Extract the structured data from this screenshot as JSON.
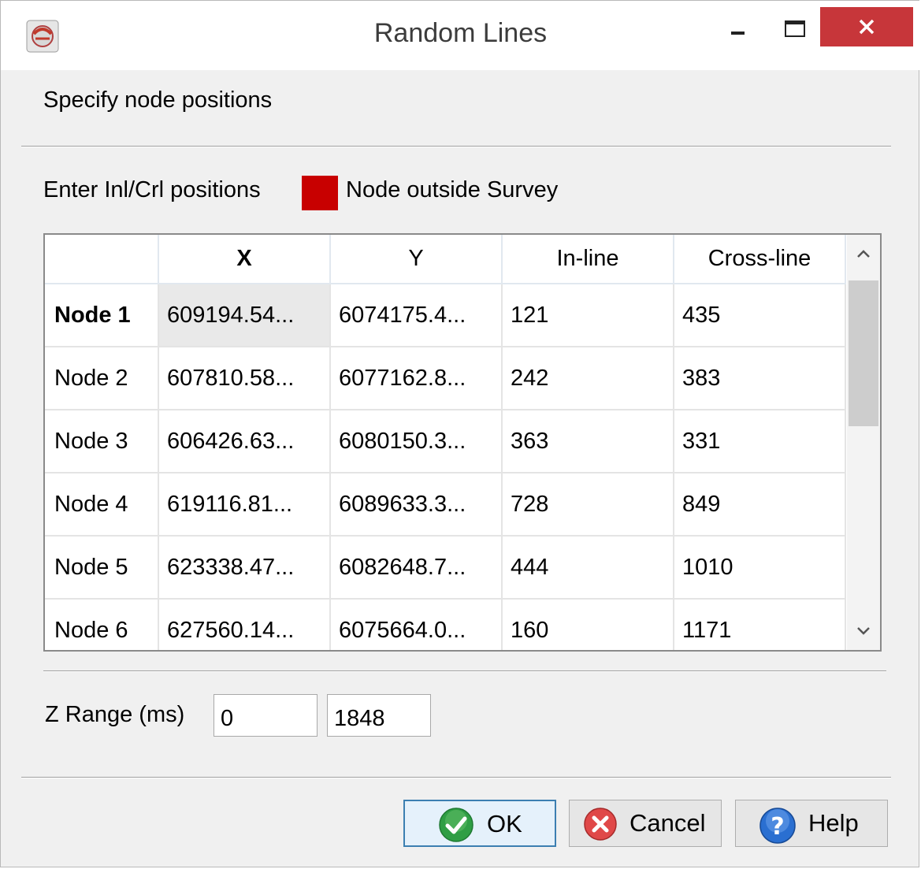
{
  "window": {
    "title": "Random Lines"
  },
  "prompt": "Specify node positions",
  "legend": {
    "label": "Enter Inl/Crl positions",
    "swatch_color": "#c80000",
    "swatch_label": "Node outside Survey"
  },
  "table": {
    "columns": [
      "",
      "X",
      "Y",
      "In-line",
      "Cross-line"
    ],
    "rows": [
      {
        "node": "Node 1",
        "x": "609194.54...",
        "y": "6074175.4...",
        "inline": "121",
        "crossline": "435"
      },
      {
        "node": "Node 2",
        "x": "607810.58...",
        "y": "6077162.8...",
        "inline": "242",
        "crossline": "383"
      },
      {
        "node": "Node 3",
        "x": "606426.63...",
        "y": "6080150.3...",
        "inline": "363",
        "crossline": "331"
      },
      {
        "node": "Node 4",
        "x": "619116.81...",
        "y": "6089633.3...",
        "inline": "728",
        "crossline": "849"
      },
      {
        "node": "Node 5",
        "x": "623338.47...",
        "y": "6082648.7...",
        "inline": "444",
        "crossline": "1010"
      },
      {
        "node": "Node 6",
        "x": "627560.14...",
        "y": "6075664.0...",
        "inline": "160",
        "crossline": "1171"
      }
    ]
  },
  "zrange": {
    "label": "Z Range (ms)",
    "start": "0",
    "stop": "1848"
  },
  "buttons": {
    "ok": "OK",
    "cancel": "Cancel",
    "help": "Help"
  }
}
